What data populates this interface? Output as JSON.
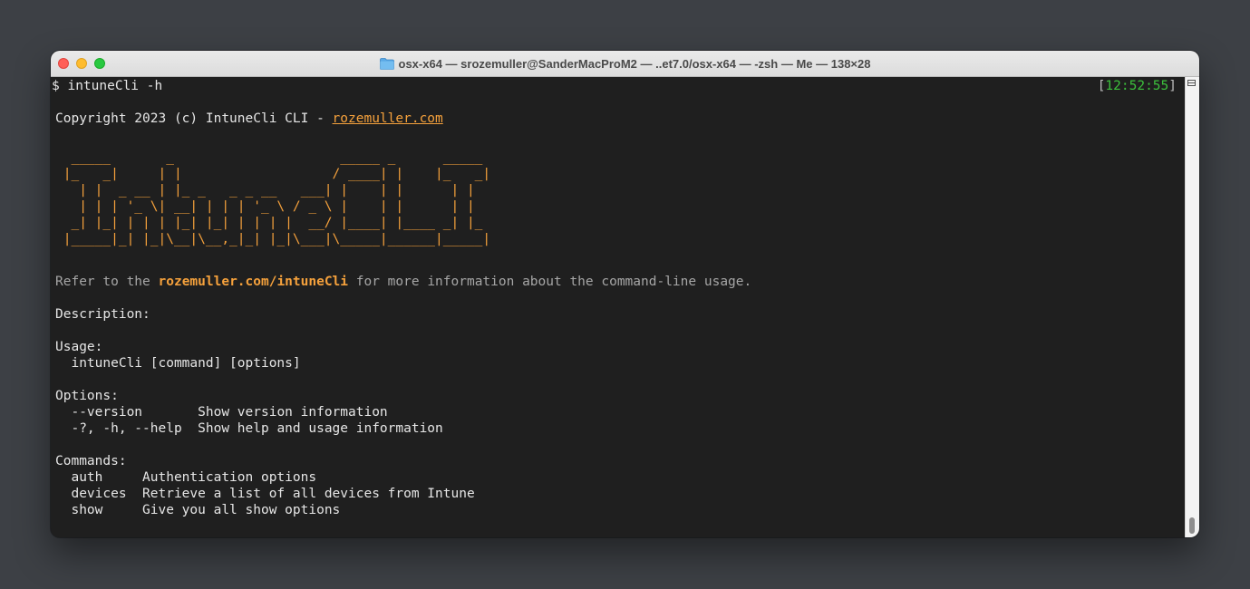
{
  "window": {
    "title": "osx-x64 — srozemuller@SanderMacProM2 — ..et7.0/osx-x64 — -zsh — Me — 138×28",
    "folder_icon": "folder-icon"
  },
  "terminal": {
    "prompt_line": "$ intuneCli -h",
    "clock": "12:52:55",
    "copyright_prefix": "Copyright 2023 (c) IntuneCli CLI - ",
    "copyright_link": "rozemuller.com",
    "ascii_art": "  _____       _                     _____ _      _____ \n |_   _|     | |                   / ____| |    |_   _|\n   | |  _ __ | |_ _   _ _ __   ___| |    | |      | |  \n   | | | '_ \\| __| | | | '_ \\ / _ \\ |    | |      | |  \n  _| |_| | | | |_| |_| | | | |  __/ |____| |____ _| |_ \n |_____|_| |_|\\__|\\__,_|_| |_|\\___|\\_____|______|_____|",
    "refer_prefix": "Refer to the ",
    "refer_link": "rozemuller.com/intuneCli",
    "refer_suffix": " for more information about the command-line usage.",
    "description_label": "Description:",
    "usage_label": "Usage:",
    "usage_line": "  intuneCli [command] [options]",
    "options_label": "Options:",
    "options": [
      {
        "flag": "  --version       ",
        "desc": "Show version information"
      },
      {
        "flag": "  -?, -h, --help  ",
        "desc": "Show help and usage information"
      }
    ],
    "commands_label": "Commands:",
    "commands": [
      {
        "name": "  auth     ",
        "desc": "Authentication options"
      },
      {
        "name": "  devices  ",
        "desc": "Retrieve a list of all devices from Intune"
      },
      {
        "name": "  show     ",
        "desc": "Give you all show options"
      }
    ]
  },
  "colors": {
    "background": "#3d4045",
    "terminal_bg": "#1f1f1f",
    "accent_orange": "#f5a13c",
    "clock_green": "#3cc03c",
    "close": "#ff5f57",
    "minimize": "#febc2e",
    "maximize": "#28c840"
  }
}
